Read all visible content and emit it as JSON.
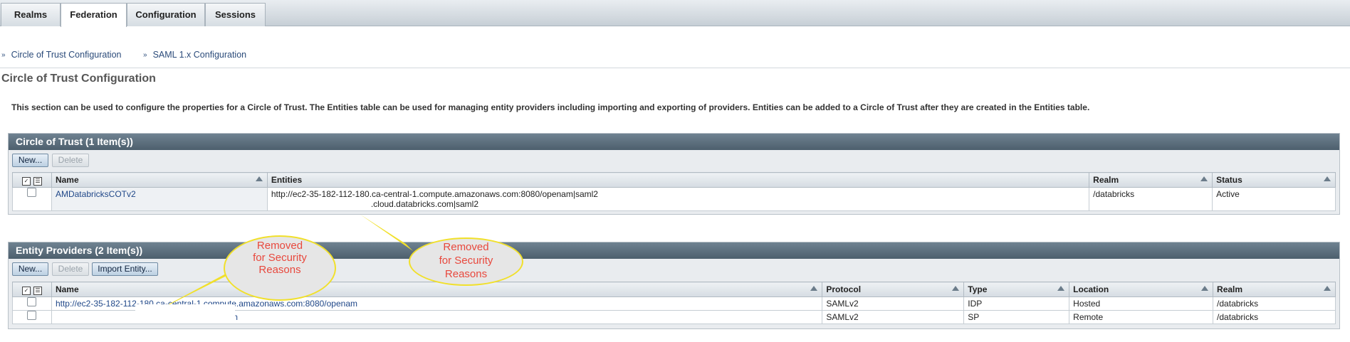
{
  "tabs": [
    {
      "label": "Realms"
    },
    {
      "label": "Federation"
    },
    {
      "label": "Configuration"
    },
    {
      "label": "Sessions"
    }
  ],
  "subnav": [
    {
      "label": "Circle of Trust Configuration"
    },
    {
      "label": "SAML 1.x Configuration"
    }
  ],
  "page_title": "Circle of Trust Configuration",
  "description": "This section can be used to configure the properties for a Circle of Trust. The Entities table can be used for managing entity providers including importing and exporting of providers. Entities can be added to a Circle of Trust after they are created in the Entities table.",
  "cot": {
    "title": "Circle of Trust (1 Item(s))",
    "new_label": "New...",
    "delete_label": "Delete",
    "headers": {
      "name": "Name",
      "entities": "Entities",
      "realm": "Realm",
      "status": "Status"
    },
    "rows": [
      {
        "name": "AMDatabricksCOTv2",
        "entity_line1": "http://ec2-35-182-112-180.ca-central-1.compute.amazonaws.com:8080/openam|saml2",
        "entity_line2": ".cloud.databricks.com|saml2",
        "realm": "/databricks",
        "status": "Active"
      }
    ]
  },
  "providers": {
    "title": "Entity Providers (2 Item(s))",
    "new_label": "New...",
    "delete_label": "Delete",
    "import_label": "Import Entity...",
    "headers": {
      "name": "Name",
      "protocol": "Protocol",
      "type": "Type",
      "location": "Location",
      "realm": "Realm"
    },
    "rows": [
      {
        "name": "http://ec2-35-182-112-180.ca-central-1.compute.amazonaws.com:8080/openam",
        "protocol": "SAMLv2",
        "type": "IDP",
        "location": "Hosted",
        "realm": "/databricks"
      },
      {
        "name": ".cloud.databricks.com",
        "protocol": "SAMLv2",
        "type": "SP",
        "location": "Remote",
        "realm": "/databricks"
      }
    ]
  },
  "annotations": {
    "left": {
      "line1": "Removed",
      "line2": "for Security",
      "line3": "Reasons"
    },
    "right": {
      "line1": "Removed",
      "line2": "for Security",
      "line3": "Reasons"
    }
  },
  "icons": {
    "sort": "sort-ascending-icon",
    "subnav": "chevron-double-down-icon",
    "select_all": "select-all-icon",
    "deselect_all": "deselect-all-icon"
  },
  "colors": {
    "panel_header": "#56697a",
    "link": "#1f4788",
    "annotation_text": "#e8483d",
    "annotation_border": "#f1e02a"
  }
}
